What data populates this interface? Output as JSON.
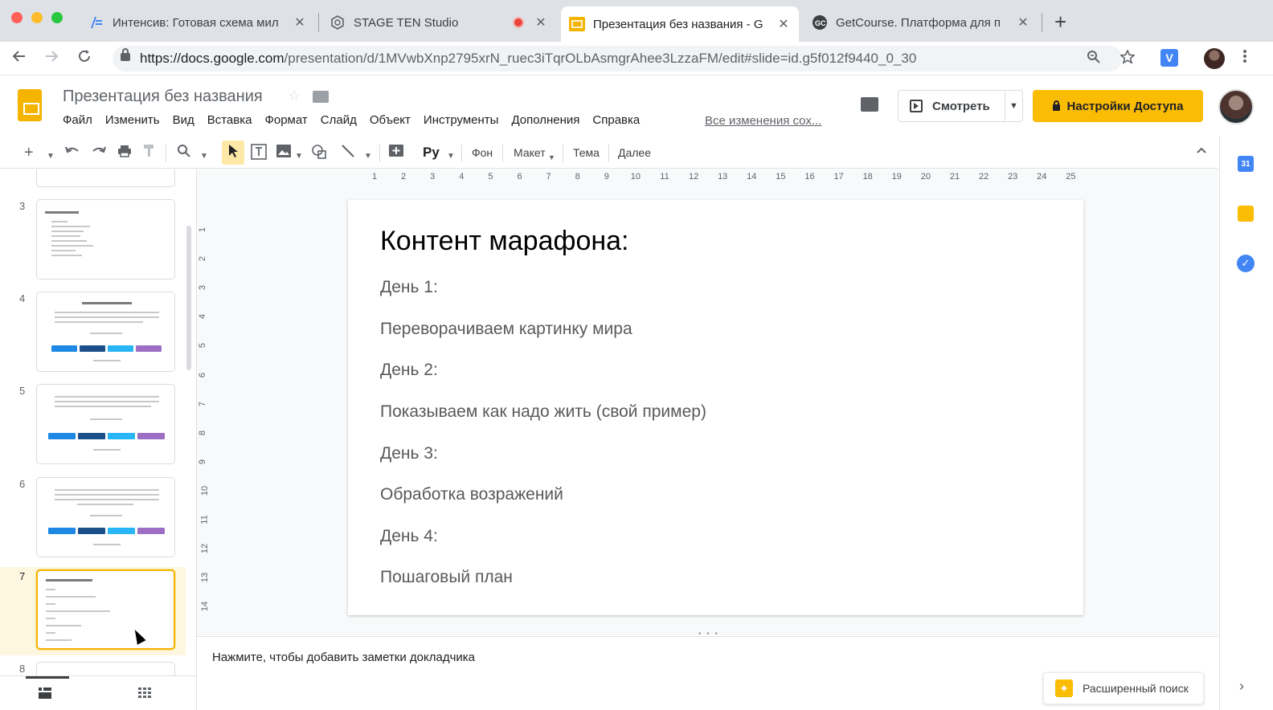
{
  "browser": {
    "tabs": [
      {
        "title": "Интенсив: Готовая схема мил",
        "icon": "doc-icon",
        "active": false
      },
      {
        "title": "STAGE TEN Studio",
        "icon": "stage-ten-icon",
        "active": false,
        "recording": true
      },
      {
        "title": "Презентация без названия - G",
        "icon": "slides-icon",
        "active": true
      },
      {
        "title": "GetCourse. Платформа для п",
        "icon": "getcourse-icon",
        "active": false
      }
    ],
    "close_glyph": "✕",
    "new_tab_glyph": "+",
    "url_host": "https://docs.google.com",
    "url_path": "/presentation/d/1MVwbXnp2795xrN_ruec3iTqrOLbAsmgrAhee3LzzaFM/edit#slide=id.g5f012f9440_0_30",
    "ext_label": "V"
  },
  "header": {
    "doc_title": "Презентация без названия",
    "menu": [
      "Файл",
      "Изменить",
      "Вид",
      "Вставка",
      "Формат",
      "Слайд",
      "Объект",
      "Инструменты",
      "Дополнения",
      "Справка"
    ],
    "saved_status": "Все изменения сох...",
    "present_label": "Смотреть",
    "share_label": "Настройки Доступа"
  },
  "toolbar": {
    "background_label": "Фон",
    "layout_label": "Макет",
    "theme_label": "Тема",
    "more_label": "Далее"
  },
  "filmstrip": {
    "slide_numbers": [
      "3",
      "4",
      "5",
      "6",
      "7",
      "8"
    ],
    "selected_slide": "7"
  },
  "ruler": {
    "horizontal": [
      "1",
      "2",
      "3",
      "4",
      "5",
      "6",
      "7",
      "8",
      "9",
      "10",
      "11",
      "12",
      "13",
      "14",
      "15",
      "16",
      "17",
      "18",
      "19",
      "20",
      "21",
      "22",
      "23",
      "24",
      "25"
    ],
    "vertical": [
      "1",
      "2",
      "3",
      "4",
      "5",
      "6",
      "7",
      "8",
      "9",
      "10",
      "11",
      "12",
      "13",
      "14"
    ]
  },
  "slide": {
    "title": "Контент марафона:",
    "lines": [
      "День 1:",
      "Переворачиваем картинку мира",
      "День 2:",
      "Показываем как надо жить (свой пример)",
      "День 3:",
      "Обработка возражений",
      "День 4:",
      "Пошаговый план"
    ]
  },
  "notes": {
    "placeholder": "Нажмите, чтобы добавить заметки докладчика"
  },
  "explore": {
    "label": "Расширенный поиск"
  },
  "side_panel": {
    "calendar_label": "31",
    "tasks_glyph": "✓"
  },
  "colors": {
    "accent": "#fbbc04",
    "slides_brand": "#f4b400",
    "tab_strip": "#dee1e6",
    "link_blue": "#4285f4"
  }
}
